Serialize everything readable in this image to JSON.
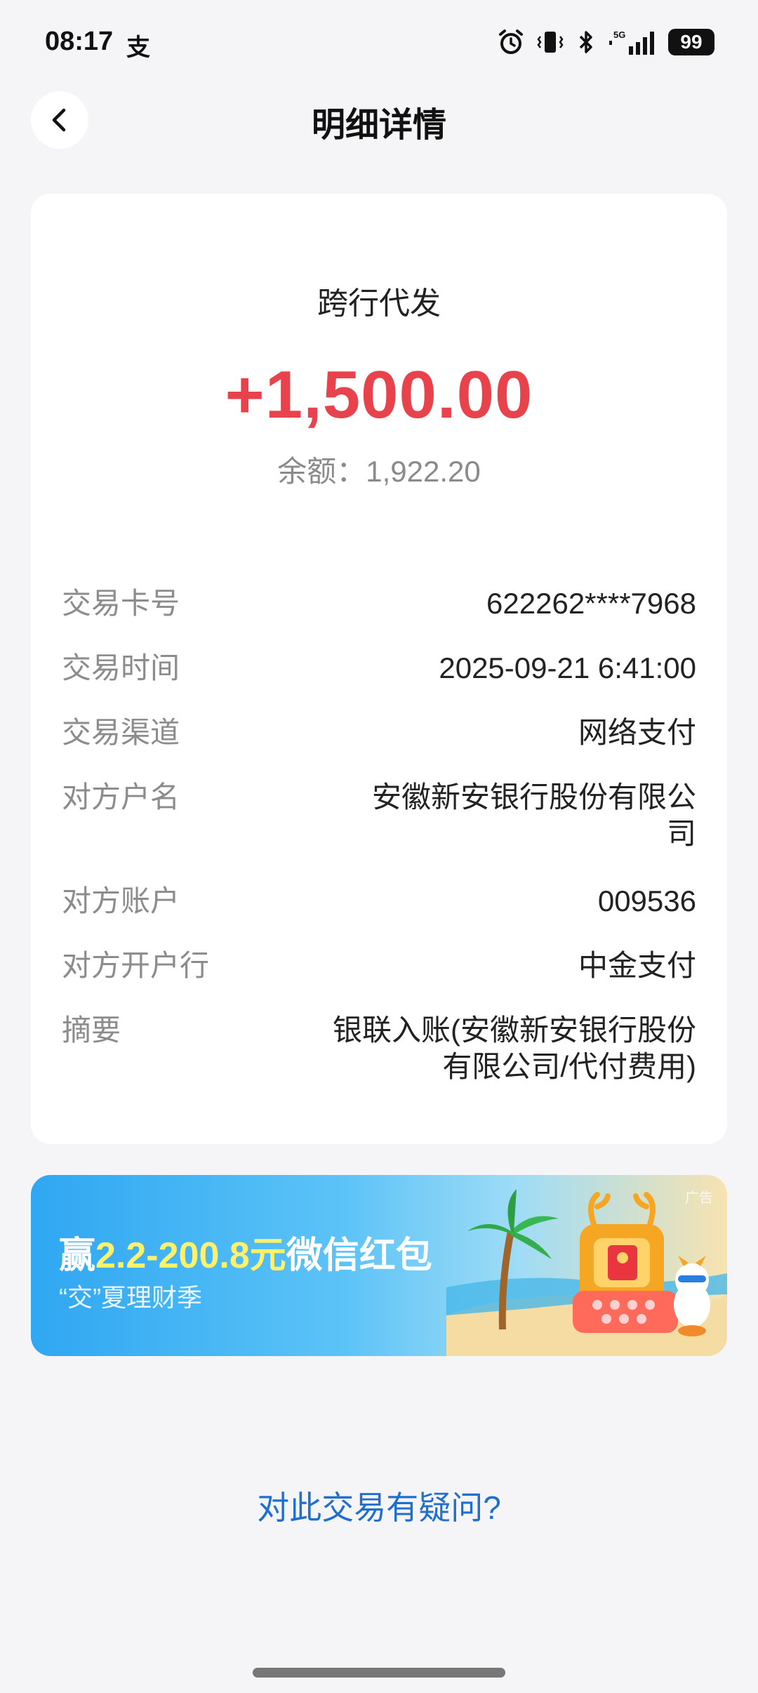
{
  "status_bar": {
    "time": "08:17",
    "app_glyph": "支",
    "network": "5G",
    "battery": "99",
    "icons": [
      "alarm-icon",
      "vibrate-icon",
      "bluetooth-icon",
      "signal-icon",
      "battery-icon"
    ]
  },
  "header": {
    "title": "明细详情",
    "back_icon": "chevron-left-icon"
  },
  "transaction": {
    "type": "跨行代发",
    "amount": "+1,500.00",
    "balance_label": "余额：",
    "balance_value": "1,922.20",
    "amount_color": "#e8434d"
  },
  "details": [
    {
      "label": "交易卡号",
      "value": "622262****7968"
    },
    {
      "label": "交易时间",
      "value": "2025-09-21 6:41:00"
    },
    {
      "label": "交易渠道",
      "value": "网络支付"
    },
    {
      "label": "对方户名",
      "value": "安徽新安银行股份有限公司"
    },
    {
      "label": "对方账户",
      "value": "009536"
    },
    {
      "label": "对方开户行",
      "value": "中金支付"
    },
    {
      "label": "摘要",
      "value": "银联入账(安徽新安银行股份有限公司/代付费用)"
    }
  ],
  "promo": {
    "title_prefix": "赢",
    "title_highlight": "2.2-200.8元",
    "title_suffix": "微信红包",
    "subtitle": "“交”夏理财季",
    "ad_tag": "广告"
  },
  "footer": {
    "question_link": "对此交易有疑问?",
    "link_color": "#1f6fd1"
  }
}
